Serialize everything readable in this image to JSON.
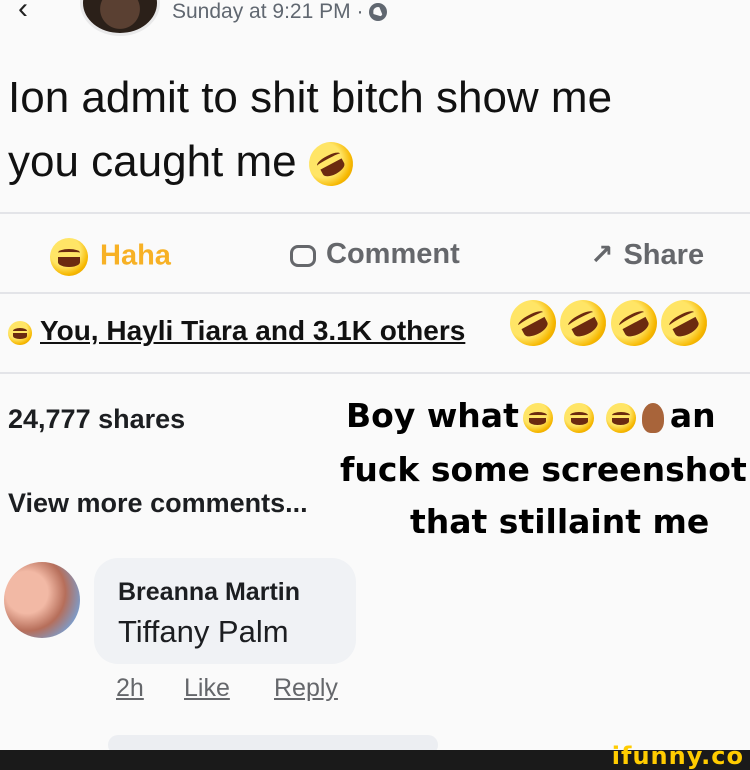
{
  "post": {
    "timestamp": "Sunday at 9:21 PM ·",
    "text_line1": "Ion admit to shit bitch show me",
    "text_line2": "you caught me"
  },
  "actions": {
    "haha": "Haha",
    "comment": "Comment",
    "share": "Share",
    "share_icon": "↗"
  },
  "reactions": {
    "summary": "You, Hayli Tiara and 3.1K others",
    "shares": "24,777 shares",
    "view_more": "View more comments..."
  },
  "overlay_caption": {
    "line1": "Boy what",
    "line1_end": "an",
    "line2": "fuck some screenshot",
    "line3": "that stillaint me"
  },
  "comment": {
    "author": "Breanna Martin",
    "text": "Tiffany Palm",
    "time": "2h",
    "like": "Like",
    "reply": "Reply"
  },
  "watermark": "ifunny.co",
  "icons": {
    "back": "arrow-left-icon",
    "globe": "globe-icon",
    "haha": "haha-emoji-icon",
    "comment": "comment-bubble-icon",
    "share": "share-arrow-icon",
    "rofl": "rofl-emoji-icon"
  },
  "colors": {
    "haha_accent": "#f7b125",
    "muted": "#65676b",
    "bubble": "#f0f2f5"
  }
}
